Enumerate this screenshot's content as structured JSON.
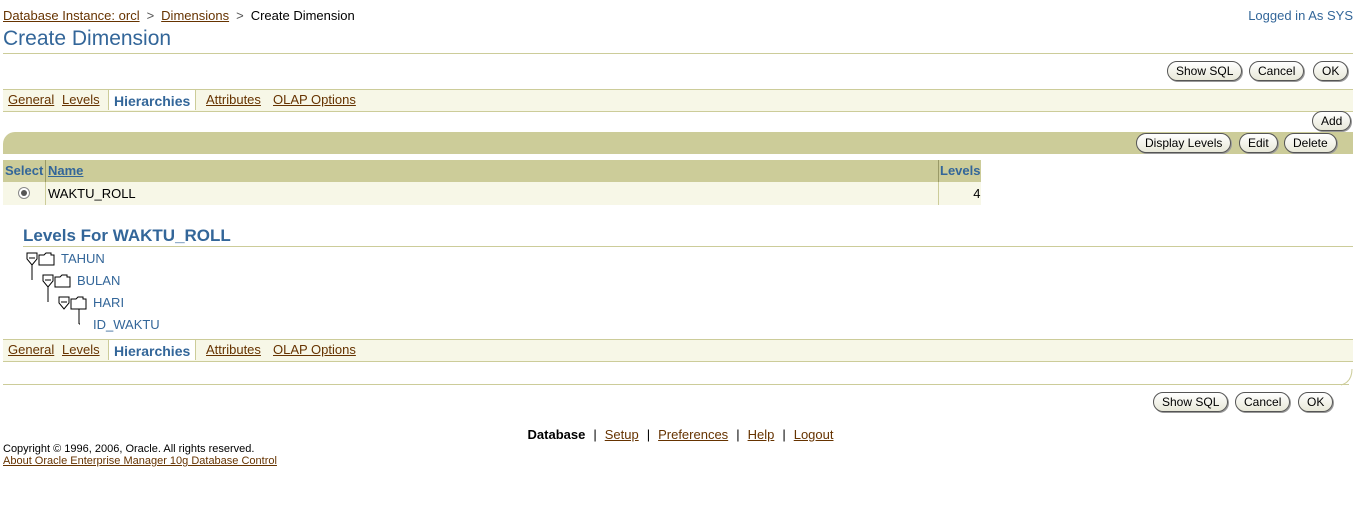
{
  "breadcrumb": {
    "database_instance": "Database Instance: orcl",
    "dimensions": "Dimensions",
    "separator": ">",
    "current": "Create Dimension"
  },
  "login_status": "Logged in As SYS",
  "page_title": "Create Dimension",
  "top_buttons": {
    "show_sql": "Show SQL",
    "cancel": "Cancel",
    "ok": "OK"
  },
  "tabs": [
    {
      "label": "General",
      "active": false
    },
    {
      "label": "Levels",
      "active": false
    },
    {
      "label": "Hierarchies",
      "active": true
    },
    {
      "label": "Attributes",
      "active": false
    },
    {
      "label": "OLAP Options",
      "active": false
    }
  ],
  "actions": {
    "add": "Add",
    "display_levels": "Display Levels",
    "edit": "Edit",
    "delete": "Delete"
  },
  "table": {
    "headers": {
      "select": "Select",
      "name": "Name",
      "levels": "Levels"
    },
    "rows": [
      {
        "selected": true,
        "name": "WAKTU_ROLL",
        "levels": "4"
      }
    ]
  },
  "levels_section": {
    "title": "Levels For WAKTU_ROLL",
    "tree": [
      "TAHUN",
      "BULAN",
      "HARI",
      "ID_WAKTU"
    ]
  },
  "bottom_buttons": {
    "show_sql": "Show SQL",
    "cancel": "Cancel",
    "ok": "OK"
  },
  "footer": {
    "database": "Database",
    "setup": "Setup",
    "preferences": "Preferences",
    "help": "Help",
    "logout": "Logout",
    "separator": "|",
    "copyright": "Copyright © 1996, 2006, Oracle. All rights reserved.",
    "about": "About Oracle Enterprise Manager 10g Database Control"
  },
  "colors": {
    "accent": "#336699",
    "link": "#663300",
    "band": "#cccc99",
    "band_light": "#f7f7e7"
  }
}
